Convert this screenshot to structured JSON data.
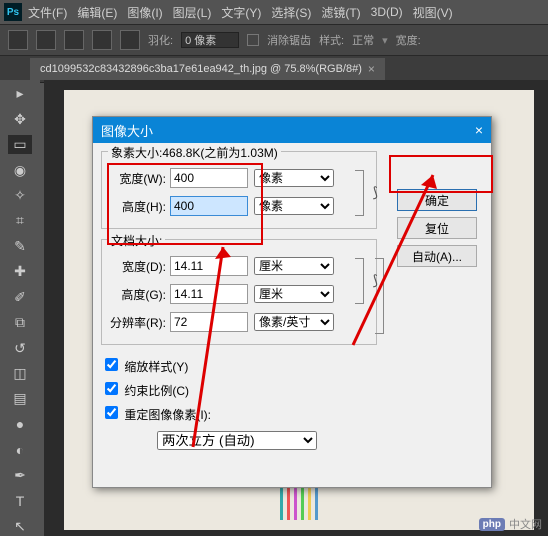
{
  "app": {
    "logo": "Ps"
  },
  "menu": {
    "file": "文件(F)",
    "edit": "编辑(E)",
    "image": "图像(I)",
    "layer": "图层(L)",
    "type": "文字(Y)",
    "select": "选择(S)",
    "filter": "滤镜(T)",
    "threeD": "3D(D)",
    "view": "视图(V)"
  },
  "options": {
    "feather_label": "羽化:",
    "feather_value": "0 像素",
    "antialias": "消除锯齿",
    "style_label": "样式:",
    "style_value": "正常",
    "width_label": "宽度:"
  },
  "tab": {
    "title": "cd1099532c83432896c3ba17e61ea942_th.jpg @ 75.8%(RGB/8#)",
    "close": "×"
  },
  "dialog": {
    "title": "图像大小",
    "close": "×",
    "pixel_section": {
      "legend_prefix": "象素大小:",
      "size": "468.8K",
      "prev": "(之前为1.03M)",
      "width_label": "宽度(W):",
      "width_value": "400",
      "width_unit": "像素",
      "height_label": "高度(H):",
      "height_value": "400",
      "height_unit": "像素"
    },
    "doc_section": {
      "legend": "文档大小:",
      "width_label": "宽度(D):",
      "width_value": "14.11",
      "width_unit": "厘米",
      "height_label": "高度(G):",
      "height_value": "14.11",
      "height_unit": "厘米",
      "res_label": "分辨率(R):",
      "res_value": "72",
      "res_unit": "像素/英寸"
    },
    "buttons": {
      "ok": "确定",
      "reset": "复位",
      "auto": "自动(A)..."
    },
    "checks": {
      "scale_styles": "缩放样式(Y)",
      "constrain": "约束比例(C)",
      "resample": "重定图像像素(I):"
    },
    "resample_method": "两次立方 (自动)"
  },
  "watermark": {
    "badge": "php",
    "text": "中文网"
  }
}
